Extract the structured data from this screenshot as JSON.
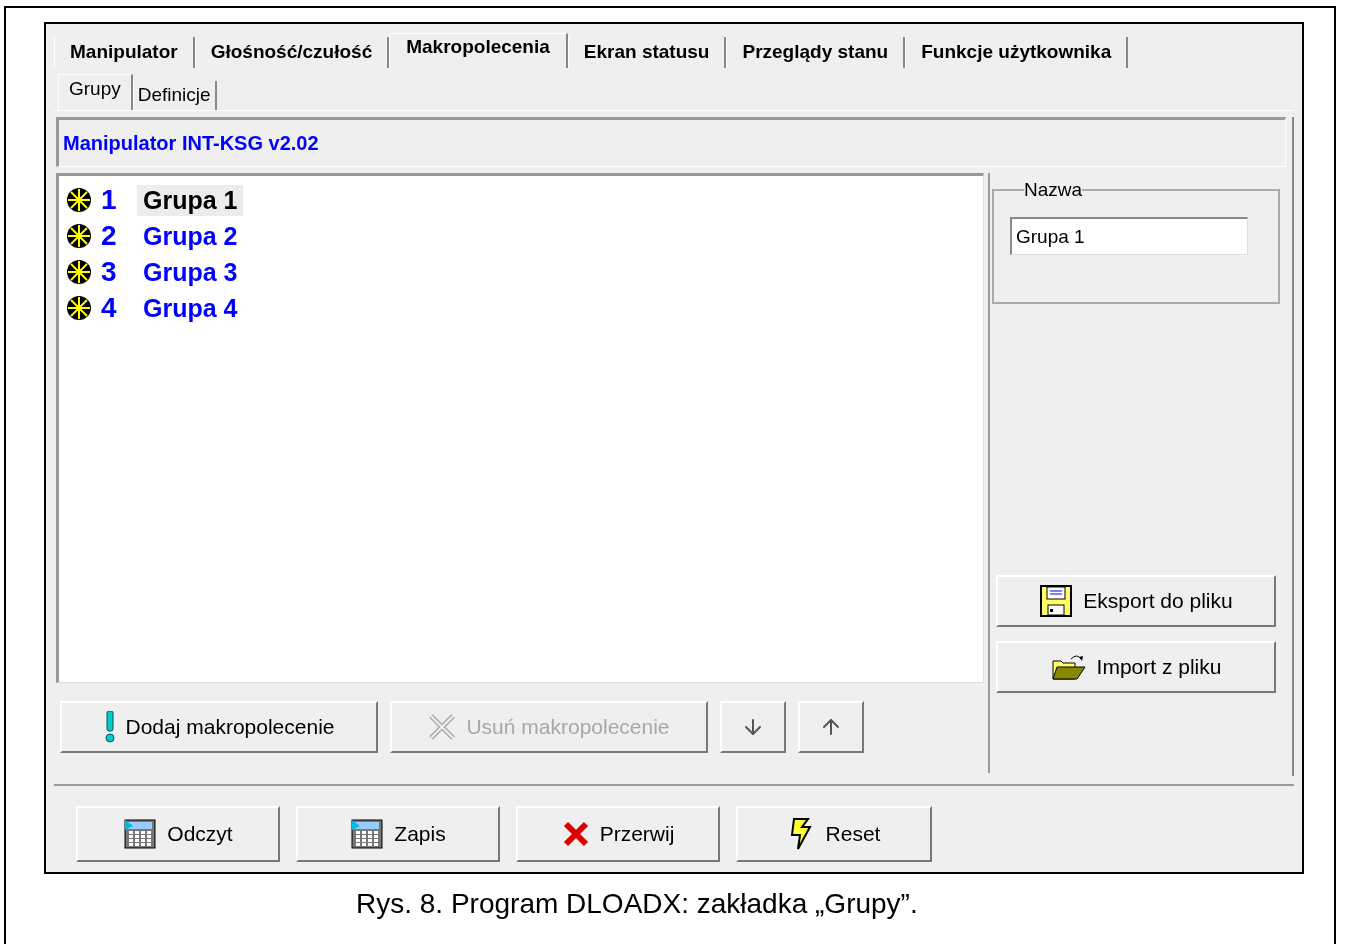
{
  "tabs": [
    {
      "label": "Manipulator",
      "selected": false
    },
    {
      "label": "Głośność/czułość",
      "selected": false
    },
    {
      "label": "Makropolecenia",
      "selected": true
    },
    {
      "label": "Ekran statusu",
      "selected": false
    },
    {
      "label": "Przeglądy stanu",
      "selected": false
    },
    {
      "label": "Funkcje użytkownika",
      "selected": false
    }
  ],
  "subtabs": [
    {
      "label": "Grupy",
      "selected": true
    },
    {
      "label": "Definicje",
      "selected": false
    }
  ],
  "header": "Manipulator INT-KSG v2.02",
  "groups": [
    {
      "number": "1",
      "name": "Grupa 1",
      "selected": true
    },
    {
      "number": "2",
      "name": "Grupa 2",
      "selected": false
    },
    {
      "number": "3",
      "name": "Grupa 3",
      "selected": false
    },
    {
      "number": "4",
      "name": "Grupa 4",
      "selected": false
    }
  ],
  "list_buttons": [
    {
      "kind": "add",
      "label": "Dodaj makropolecenie",
      "disabled": false
    },
    {
      "kind": "remove",
      "label": "Usuń makropolecenie",
      "disabled": true
    },
    {
      "kind": "down",
      "disabled": false
    },
    {
      "kind": "up",
      "disabled": false
    }
  ],
  "name_field": {
    "label": "Nazwa",
    "value": "Grupa 1"
  },
  "side_buttons": [
    {
      "kind": "export",
      "label": "Eksport do pliku"
    },
    {
      "kind": "import",
      "label": "Import z pliku"
    }
  ],
  "bottom_buttons": [
    {
      "kind": "read",
      "label": "Odczyt"
    },
    {
      "kind": "write",
      "label": "Zapis"
    },
    {
      "kind": "abort",
      "label": "Przerwij"
    },
    {
      "kind": "reset",
      "label": "Reset"
    }
  ],
  "caption": "Rys. 8. Program DLOADX: zakładka „Grupy”."
}
